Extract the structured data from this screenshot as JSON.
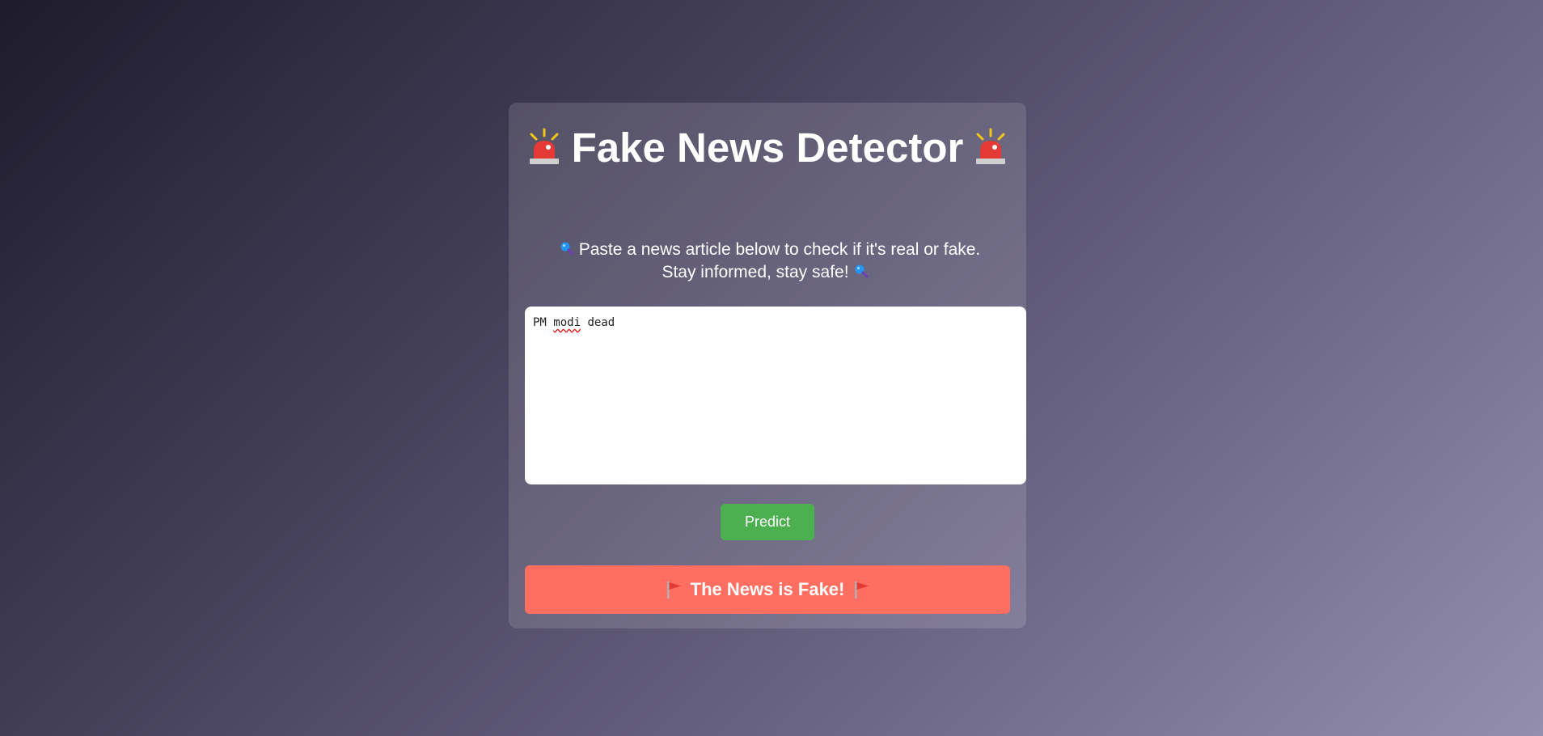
{
  "app": {
    "title": "Fake News Detector",
    "subtitle": "Paste a news article below to check if it's real or fake. Stay informed, stay safe!",
    "title_icon": "police-car-light-icon",
    "subtitle_icon": "magnifying-glass-icon"
  },
  "form": {
    "article_text": "PM modi dead",
    "predict_label": "Predict"
  },
  "result": {
    "text": "The News is Fake!",
    "icon": "red-flag-icon",
    "color": "#ff6f61"
  },
  "colors": {
    "button": "#4caf50",
    "result_bg": "#ff6f61"
  }
}
